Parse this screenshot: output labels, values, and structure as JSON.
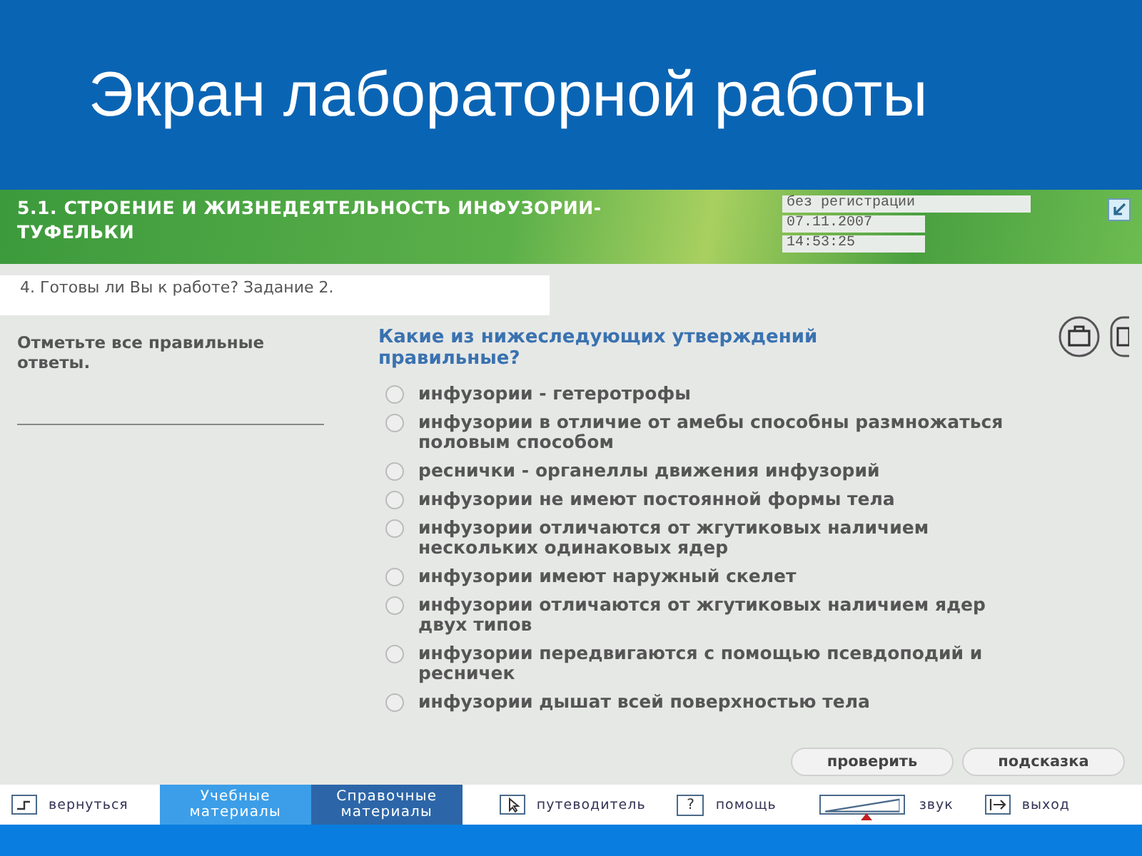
{
  "slide_title": "Экран лабораторной работы",
  "header": {
    "title": "5.1. СТРОЕНИЕ И ЖИЗНЕДЕЯТЕЛЬНОСТЬ ИНФУЗОРИИ-ТУФЕЛЬКИ",
    "user": "без регистрации",
    "date": "07.11.2007",
    "time": "14:53:25"
  },
  "task": "4. Готовы ли Вы к работе? Задание 2.",
  "instruction": "Отметьте все правильные ответы.",
  "question": "Какие из нижеследующих утверждений правильные?",
  "options": [
    {
      "text": "инфузории - гетеротрофы",
      "selected": false
    },
    {
      "text": "инфузории в отличие от амебы способны размножаться половым способом",
      "selected": false
    },
    {
      "text": "реснички - органеллы движения инфузорий",
      "selected": false
    },
    {
      "text": "инфузории не имеют постоянной формы тела",
      "selected": false
    },
    {
      "text": "инфузории отличаются от жгутиковых наличием нескольких одинаковых ядер",
      "selected": false
    },
    {
      "text": "инфузории имеют наружный скелет",
      "selected": false
    },
    {
      "text": "инфузории отличаются от жгутиковых наличием ядер двух типов",
      "selected": false
    },
    {
      "text": "инфузории передвигаются с помощью псевдоподий и ресничек",
      "selected": false
    },
    {
      "text": "инфузории дышат всей поверхностью тела",
      "selected": false
    }
  ],
  "buttons": [
    "проверить",
    "подсказка"
  ],
  "toolbar": {
    "back": "вернуться",
    "tabs": [
      {
        "label": "Учебные материалы",
        "selected": true
      },
      {
        "label": "Справочные материалы",
        "selected": false
      }
    ],
    "guide": "путеводитель",
    "help_glyph": "?",
    "help": "помощь",
    "sound": {
      "level": 0.55,
      "label": "звук"
    },
    "exit": "выход"
  }
}
